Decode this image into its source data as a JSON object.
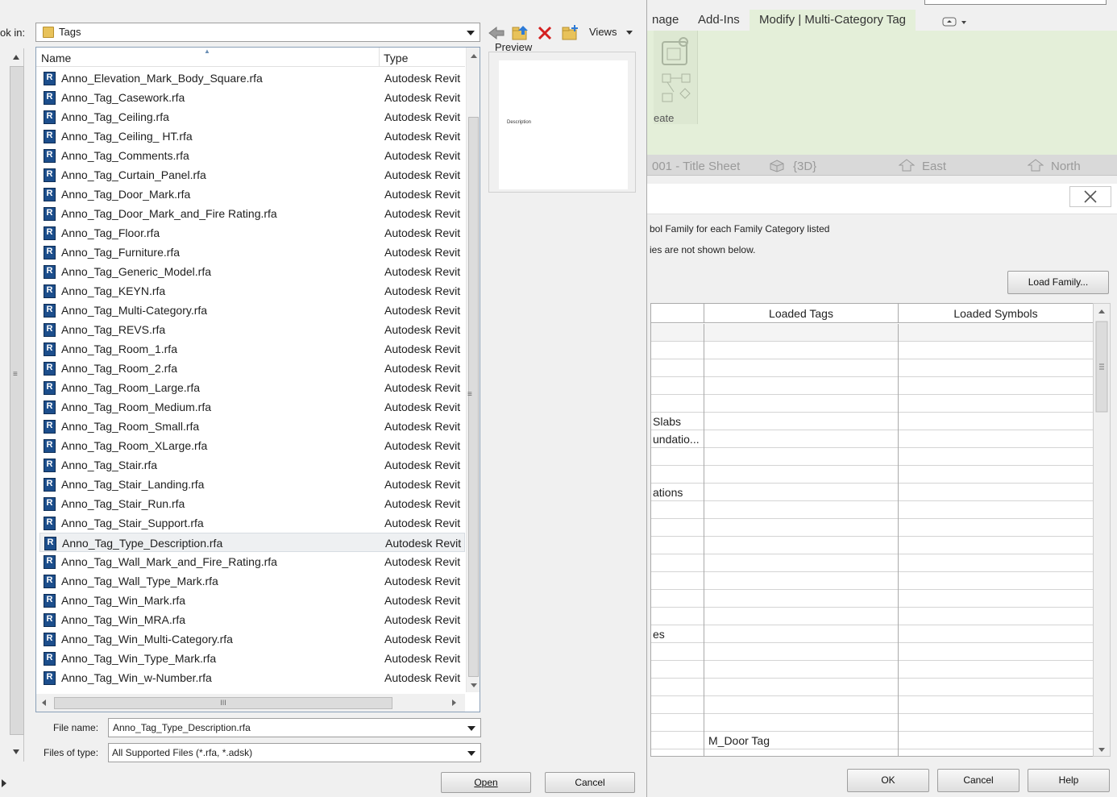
{
  "revit": {
    "ribbon_tabs": [
      "nage",
      "Add-Ins",
      "Modify | Multi-Category Tag"
    ],
    "ribbon_group_label": "eate",
    "view_tabs": [
      "001 - Title Sheet",
      "{3D}",
      "East",
      "North"
    ],
    "tag_dialog": {
      "note1": "bol Family for each Family Category listed",
      "note2": "ies are not shown below.",
      "load_family_label": "Load Family...",
      "columns": [
        "Loaded Tags",
        "Loaded Symbols"
      ],
      "rows": [
        {
          "cat": "",
          "tag": "",
          "sym": ""
        },
        {
          "cat": "",
          "tag": "",
          "sym": ""
        },
        {
          "cat": "",
          "tag": "",
          "sym": ""
        },
        {
          "cat": "",
          "tag": "",
          "sym": ""
        },
        {
          "cat": "",
          "tag": "",
          "sym": ""
        },
        {
          "cat": "Slabs",
          "tag": "",
          "sym": ""
        },
        {
          "cat": "undatio...",
          "tag": "",
          "sym": ""
        },
        {
          "cat": "",
          "tag": "",
          "sym": ""
        },
        {
          "cat": "",
          "tag": "",
          "sym": ""
        },
        {
          "cat": "ations",
          "tag": "",
          "sym": ""
        },
        {
          "cat": "",
          "tag": "",
          "sym": ""
        },
        {
          "cat": "",
          "tag": "",
          "sym": ""
        },
        {
          "cat": "",
          "tag": "",
          "sym": ""
        },
        {
          "cat": "",
          "tag": "",
          "sym": ""
        },
        {
          "cat": "",
          "tag": "",
          "sym": ""
        },
        {
          "cat": "",
          "tag": "",
          "sym": ""
        },
        {
          "cat": "",
          "tag": "",
          "sym": ""
        },
        {
          "cat": "es",
          "tag": "",
          "sym": ""
        },
        {
          "cat": "",
          "tag": "",
          "sym": ""
        },
        {
          "cat": "",
          "tag": "",
          "sym": ""
        },
        {
          "cat": "",
          "tag": "",
          "sym": ""
        },
        {
          "cat": "",
          "tag": "",
          "sym": ""
        },
        {
          "cat": "",
          "tag": "",
          "sym": ""
        },
        {
          "cat": "",
          "tag": "M_Door Tag",
          "sym": ""
        },
        {
          "cat": "",
          "tag": "",
          "sym": ""
        }
      ],
      "ok_label": "OK",
      "cancel_label": "Cancel",
      "help_label": "Help"
    }
  },
  "open_dialog": {
    "look_in_label": "ok in:",
    "look_in_value": "Tags",
    "views_label": "Views",
    "preview_label": "Preview",
    "preview_text": "Description",
    "col_name": "Name",
    "col_type": "Type",
    "files": [
      "Anno_Elevation_Mark_Body_Square.rfa",
      "Anno_Tag_Casework.rfa",
      "Anno_Tag_Ceiling.rfa",
      "Anno_Tag_Ceiling_ HT.rfa",
      "Anno_Tag_Comments.rfa",
      "Anno_Tag_Curtain_Panel.rfa",
      "Anno_Tag_Door_Mark.rfa",
      "Anno_Tag_Door_Mark_and_Fire Rating.rfa",
      "Anno_Tag_Floor.rfa",
      "Anno_Tag_Furniture.rfa",
      "Anno_Tag_Generic_Model.rfa",
      "Anno_Tag_KEYN.rfa",
      "Anno_Tag_Multi-Category.rfa",
      "Anno_Tag_REVS.rfa",
      "Anno_Tag_Room_1.rfa",
      "Anno_Tag_Room_2.rfa",
      "Anno_Tag_Room_Large.rfa",
      "Anno_Tag_Room_Medium.rfa",
      "Anno_Tag_Room_Small.rfa",
      "Anno_Tag_Room_XLarge.rfa",
      "Anno_Tag_Stair.rfa",
      "Anno_Tag_Stair_Landing.rfa",
      "Anno_Tag_Stair_Run.rfa",
      "Anno_Tag_Stair_Support.rfa",
      "Anno_Tag_Type_Description.rfa",
      "Anno_Tag_Wall_Mark_and_Fire_Rating.rfa",
      "Anno_Tag_Wall_Type_Mark.rfa",
      "Anno_Tag_Win_Mark.rfa",
      "Anno_Tag_Win_MRA.rfa",
      "Anno_Tag_Win_Multi-Category.rfa",
      "Anno_Tag_Win_Type_Mark.rfa",
      "Anno_Tag_Win_w-Number.rfa"
    ],
    "file_type_text": "Autodesk Revit",
    "selected_file": "Anno_Tag_Type_Description.rfa",
    "file_name_label": "File name:",
    "file_name_value": "Anno_Tag_Type_Description.rfa",
    "files_of_type_label": "Files of type:",
    "files_of_type_value": "All Supported Files  (*.rfa, *.adsk)",
    "open_label": "Open",
    "cancel_label": "Cancel"
  },
  "colors": {
    "ribbon_green": "#e4efd9",
    "revit_blue": "#1c4e8c",
    "delete_red": "#d42020",
    "folder_yellow": "#e8c25a"
  }
}
